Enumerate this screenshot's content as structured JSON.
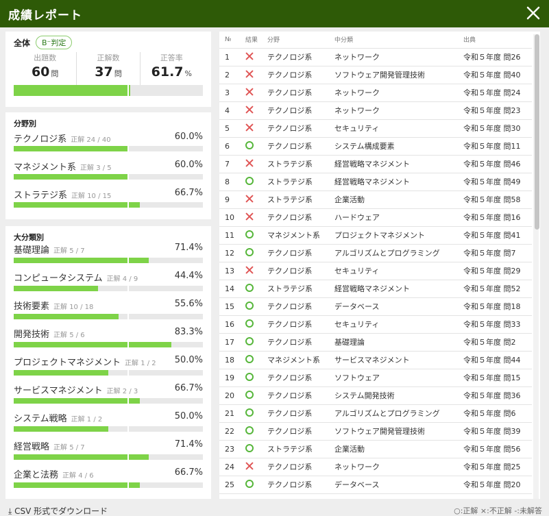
{
  "title": "成績レポート",
  "summary": {
    "label": "全体",
    "badge": "B⁻判定",
    "stats": [
      {
        "label": "出題数",
        "value": "60",
        "unit": "問"
      },
      {
        "label": "正解数",
        "value": "37",
        "unit": "問"
      },
      {
        "label": "正答率",
        "value": "61.7",
        "unit": "%"
      }
    ],
    "progress": 0.617
  },
  "fields": {
    "title": "分野別",
    "items": [
      {
        "name": "テクノロジ系",
        "count": "正解 24 / 40",
        "pct": "60.0%",
        "ratio": 0.6
      },
      {
        "name": "マネジメント系",
        "count": "正解 3 / 5",
        "pct": "60.0%",
        "ratio": 0.6
      },
      {
        "name": "ストラテジ系",
        "count": "正解 10 / 15",
        "pct": "66.7%",
        "ratio": 0.667
      }
    ]
  },
  "majors": {
    "title": "大分類別",
    "items": [
      {
        "name": "基礎理論",
        "count": "正解 5 / 7",
        "pct": "71.4%",
        "ratio": 0.714
      },
      {
        "name": "コンピュータシステム",
        "count": "正解 4 / 9",
        "pct": "44.4%",
        "ratio": 0.444
      },
      {
        "name": "技術要素",
        "count": "正解 10 / 18",
        "pct": "55.6%",
        "ratio": 0.556
      },
      {
        "name": "開発技術",
        "count": "正解 5 / 6",
        "pct": "83.3%",
        "ratio": 0.833
      },
      {
        "name": "プロジェクトマネジメント",
        "count": "正解 1 / 2",
        "pct": "50.0%",
        "ratio": 0.5
      },
      {
        "name": "サービスマネジメント",
        "count": "正解 2 / 3",
        "pct": "66.7%",
        "ratio": 0.667
      },
      {
        "name": "システム戦略",
        "count": "正解 1 / 2",
        "pct": "50.0%",
        "ratio": 0.5
      },
      {
        "name": "経営戦略",
        "count": "正解 5 / 7",
        "pct": "71.4%",
        "ratio": 0.714
      },
      {
        "name": "企業と法務",
        "count": "正解 4 / 6",
        "pct": "66.7%",
        "ratio": 0.667
      }
    ]
  },
  "table": {
    "headers": [
      "№",
      "結果",
      "分野",
      "中分類",
      "出典"
    ],
    "rows": [
      {
        "no": "1",
        "result": "ng",
        "field": "テクノロジ系",
        "category": "ネットワーク",
        "source": "令和５年度 問26"
      },
      {
        "no": "2",
        "result": "ng",
        "field": "テクノロジ系",
        "category": "ソフトウェア開発管理技術",
        "source": "令和５年度 問40"
      },
      {
        "no": "3",
        "result": "ng",
        "field": "テクノロジ系",
        "category": "ネットワーク",
        "source": "令和５年度 問24"
      },
      {
        "no": "4",
        "result": "ng",
        "field": "テクノロジ系",
        "category": "ネットワーク",
        "source": "令和５年度 問23"
      },
      {
        "no": "5",
        "result": "ng",
        "field": "テクノロジ系",
        "category": "セキュリティ",
        "source": "令和５年度 問30"
      },
      {
        "no": "6",
        "result": "ok",
        "field": "テクノロジ系",
        "category": "システム構成要素",
        "source": "令和５年度 問11"
      },
      {
        "no": "7",
        "result": "ng",
        "field": "ストラテジ系",
        "category": "経営戦略マネジメント",
        "source": "令和５年度 問46"
      },
      {
        "no": "8",
        "result": "ok",
        "field": "ストラテジ系",
        "category": "経営戦略マネジメント",
        "source": "令和５年度 問49"
      },
      {
        "no": "9",
        "result": "ng",
        "field": "ストラテジ系",
        "category": "企業活動",
        "source": "令和５年度 問58"
      },
      {
        "no": "10",
        "result": "ng",
        "field": "テクノロジ系",
        "category": "ハードウェア",
        "source": "令和５年度 問16"
      },
      {
        "no": "11",
        "result": "ok",
        "field": "マネジメント系",
        "category": "プロジェクトマネジメント",
        "source": "令和５年度 問41"
      },
      {
        "no": "12",
        "result": "ok",
        "field": "テクノロジ系",
        "category": "アルゴリズムとプログラミング",
        "source": "令和５年度 問7"
      },
      {
        "no": "13",
        "result": "ng",
        "field": "テクノロジ系",
        "category": "セキュリティ",
        "source": "令和５年度 問29"
      },
      {
        "no": "14",
        "result": "ok",
        "field": "ストラテジ系",
        "category": "経営戦略マネジメント",
        "source": "令和５年度 問52"
      },
      {
        "no": "15",
        "result": "ok",
        "field": "テクノロジ系",
        "category": "データベース",
        "source": "令和５年度 問18"
      },
      {
        "no": "16",
        "result": "ok",
        "field": "テクノロジ系",
        "category": "セキュリティ",
        "source": "令和５年度 問33"
      },
      {
        "no": "17",
        "result": "ok",
        "field": "テクノロジ系",
        "category": "基礎理論",
        "source": "令和５年度 問2"
      },
      {
        "no": "18",
        "result": "ok",
        "field": "マネジメント系",
        "category": "サービスマネジメント",
        "source": "令和５年度 問44"
      },
      {
        "no": "19",
        "result": "ok",
        "field": "テクノロジ系",
        "category": "ソフトウェア",
        "source": "令和５年度 問15"
      },
      {
        "no": "20",
        "result": "ok",
        "field": "テクノロジ系",
        "category": "システム開発技術",
        "source": "令和５年度 問36"
      },
      {
        "no": "21",
        "result": "ok",
        "field": "テクノロジ系",
        "category": "アルゴリズムとプログラミング",
        "source": "令和５年度 問6"
      },
      {
        "no": "22",
        "result": "ok",
        "field": "テクノロジ系",
        "category": "ソフトウェア開発管理技術",
        "source": "令和５年度 問39"
      },
      {
        "no": "23",
        "result": "ok",
        "field": "ストラテジ系",
        "category": "企業活動",
        "source": "令和５年度 問56"
      },
      {
        "no": "24",
        "result": "ng",
        "field": "テクノロジ系",
        "category": "ネットワーク",
        "source": "令和５年度 問25"
      },
      {
        "no": "25",
        "result": "ok",
        "field": "テクノロジ系",
        "category": "データベース",
        "source": "令和５年度 問20"
      }
    ]
  },
  "footer": {
    "download": "CSV 形式でダウンロード",
    "legend": "○:正解 ×:不正解 -:未解答"
  },
  "colors": {
    "header": "#2e5a07",
    "bar": "#7ed348",
    "correct": "#56b63a",
    "wrong": "#e05555"
  },
  "icons": {
    "close": "close-icon",
    "download": "download-icon",
    "correct": "circle-icon",
    "wrong": "cross-icon"
  }
}
